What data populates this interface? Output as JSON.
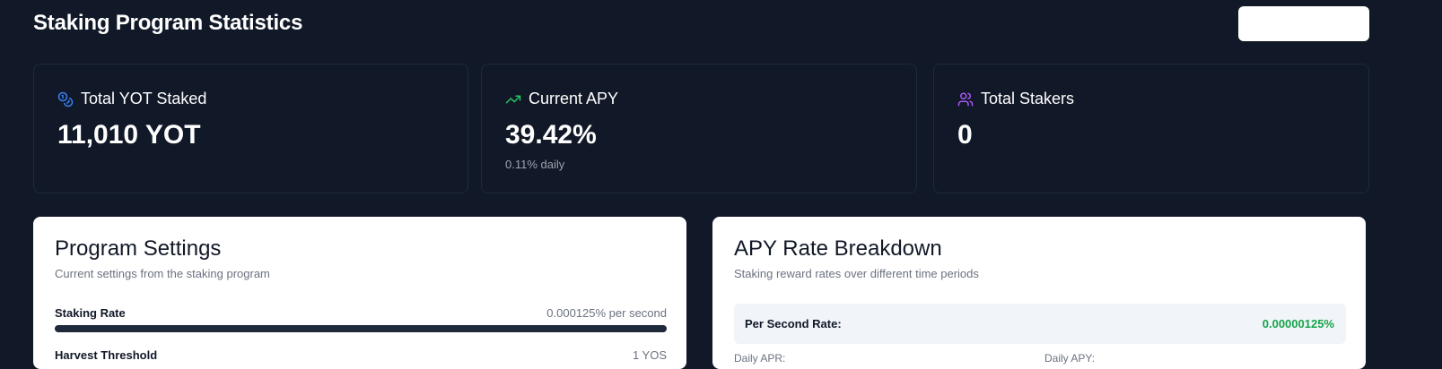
{
  "header": {
    "title": "Staking Program Statistics",
    "action_label": ""
  },
  "stats": [
    {
      "label": "Total YOT Staked",
      "value": "11,010 YOT",
      "sub": "",
      "icon": "coins-icon",
      "icon_color": "#3b82f6"
    },
    {
      "label": "Current APY",
      "value": "39.42%",
      "sub": "0.11% daily",
      "icon": "trending-up-icon",
      "icon_color": "#22c55e"
    },
    {
      "label": "Total Stakers",
      "value": "0",
      "sub": "",
      "icon": "users-icon",
      "icon_color": "#a855f7"
    }
  ],
  "settings": {
    "title": "Program Settings",
    "description": "Current settings from the staking program",
    "rows": [
      {
        "label": "Staking Rate",
        "value": "0.000125% per second",
        "bar_fraction": 1.0
      },
      {
        "label": "Harvest Threshold",
        "value": "1 YOS"
      }
    ]
  },
  "apy": {
    "title": "APY Rate Breakdown",
    "description": "Staking reward rates over different time periods",
    "per_second": {
      "label": "Per Second Rate:",
      "value": "0.00000125%"
    },
    "daily_apr_label": "Daily APR:",
    "daily_apy_label": "Daily APY:"
  },
  "colors": {
    "background": "#111827",
    "accent_green": "#16a34a",
    "bar": "#1e293b"
  }
}
